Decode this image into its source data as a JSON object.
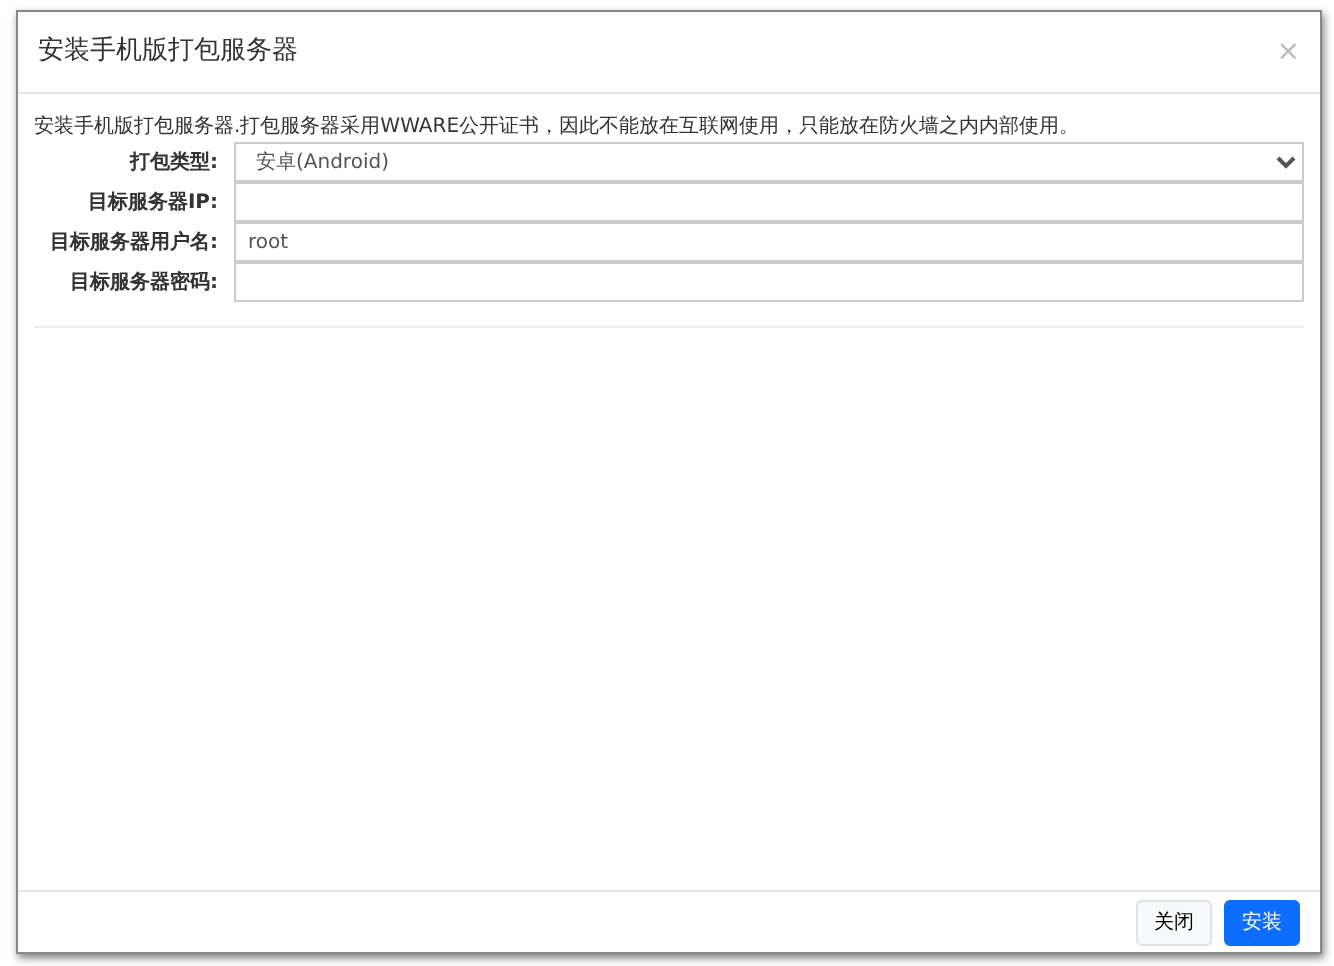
{
  "dialog": {
    "title": "安装手机版打包服务器",
    "close": "×"
  },
  "description": "安装手机版打包服务器.打包服务器采用WWARE公开证书，因此不能放在互联网使用，只能放在防火墙之内内部使用。",
  "fields": [
    {
      "kind": "select",
      "label": "打包类型:",
      "value": "安卓(Android)"
    },
    {
      "kind": "text",
      "label": "目标服务器IP:"
    },
    {
      "kind": "text",
      "label": "目标服务器用户名:",
      "value": "root"
    },
    {
      "kind": "password",
      "label": "目标服务器密码:"
    }
  ],
  "buttons": [
    {
      "label": "关闭",
      "kind": "secondary"
    },
    {
      "label": "安装",
      "kind": "primary"
    }
  ]
}
